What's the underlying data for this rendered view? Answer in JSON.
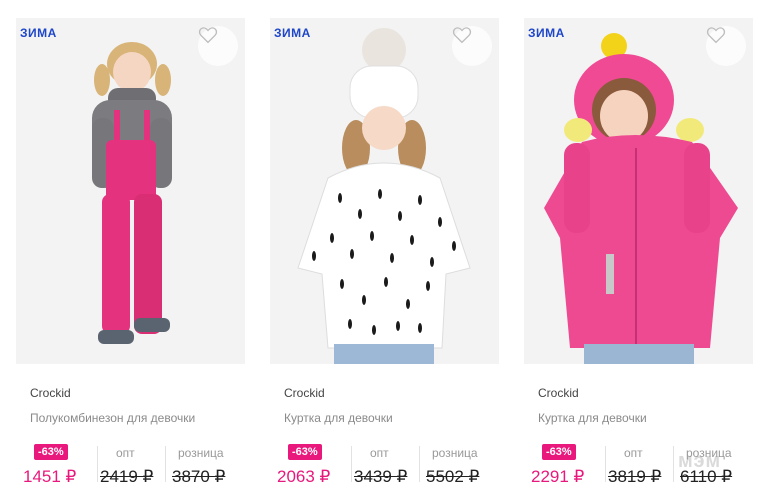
{
  "products": [
    {
      "season": "ЗИМА",
      "brand": "Crockid",
      "title": "Полукомбинезон для девочки",
      "discount": "-63%",
      "opt_label": "опт",
      "retail_label": "розница",
      "price_now": "1451 ₽",
      "price_opt": "2419 ₽",
      "price_retail": "3870 ₽"
    },
    {
      "season": "ЗИМА",
      "brand": "Crockid",
      "title": "Куртка для девочки",
      "discount": "-63%",
      "opt_label": "опт",
      "retail_label": "розница",
      "price_now": "2063 ₽",
      "price_opt": "3439 ₽",
      "price_retail": "5502 ₽"
    },
    {
      "season": "ЗИМА",
      "brand": "Crockid",
      "title": "Куртка для девочки",
      "discount": "-63%",
      "opt_label": "опт",
      "retail_label": "розница",
      "price_now": "2291 ₽",
      "price_opt": "3819 ₽",
      "price_retail": "6110 ₽"
    }
  ],
  "watermark": "мэм",
  "colors": {
    "accent_pink": "#e8187c",
    "season_blue": "#1e46c8"
  },
  "icons": [
    "heart-icon"
  ]
}
